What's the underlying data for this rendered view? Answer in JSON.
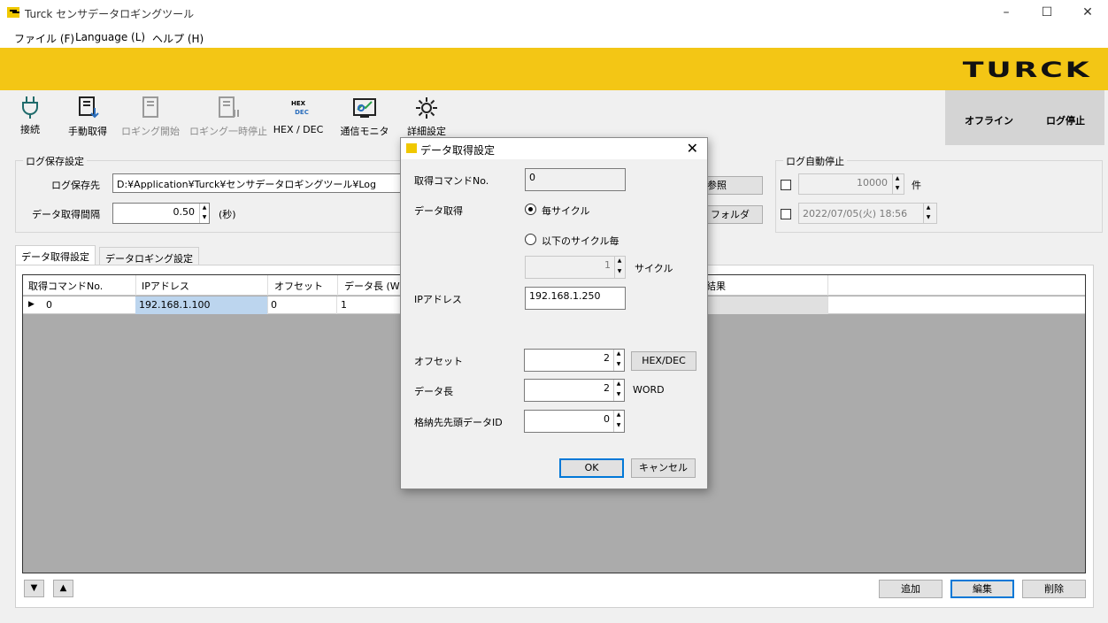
{
  "window": {
    "title": "Turck センサデータロギングツール",
    "min": "–",
    "max": "☐",
    "close": "✕"
  },
  "menu": [
    "ファイル (F)",
    "Language (L)",
    "ヘルプ (H)"
  ],
  "banner": {
    "brand": "TURCK",
    "color": "#f3c615"
  },
  "toolbar": [
    {
      "label": "接続",
      "icon": "plug-icon"
    },
    {
      "label": "手動取得",
      "icon": "notebook-download-icon"
    },
    {
      "label": "ロギング開始",
      "icon": "notebook-icon"
    },
    {
      "label": "ロギング一時停止",
      "icon": "notebook-pause-icon"
    },
    {
      "label": "HEX / DEC",
      "icon": "hex-dec-icon",
      "icon_top": "HEX",
      "icon_bottom": "DEC"
    },
    {
      "label": "通信モニタ",
      "icon": "monitor-icon"
    },
    {
      "label": "詳細設定",
      "icon": "gear-icon"
    }
  ],
  "status": {
    "connection": "オフライン",
    "logging": "ログ停止"
  },
  "log_save": {
    "group": "ログ保存設定",
    "dest_label": "ログ保存先",
    "dest_value": "D:¥Application¥Turck¥センサデータロギングツール¥Log",
    "interval_label": "データ取得間隔",
    "interval_value": "0.50",
    "interval_unit": "(秒)",
    "browse": "参照",
    "open_folder": "フォルダ"
  },
  "auto_stop": {
    "group": "ログ自動停止",
    "count_value": "10000",
    "count_unit": "件",
    "datetime_value": "2022/07/05(火) 18:56"
  },
  "tabs": [
    "データ取得設定",
    "データロギング設定"
  ],
  "grid": {
    "headers": [
      "取得コマンドNo.",
      "IPアドレス",
      "オフセット",
      "データ長 (W",
      "結果"
    ],
    "row": {
      "marker": "▶",
      "cmd": "0",
      "ip": "192.168.1.100",
      "offset": "0",
      "length": "1"
    }
  },
  "bottom_buttons": {
    "add": "追加",
    "edit": "編集",
    "delete": "削除"
  },
  "dialog": {
    "title": "データ取得設定",
    "cmd_label": "取得コマンドNo.",
    "cmd_value": "0",
    "acq_label": "データ取得",
    "opt_every": "毎サイクル",
    "opt_interval": "以下のサイクル毎",
    "cycle_value": "1",
    "cycle_unit": "サイクル",
    "ip_label": "IPアドレス",
    "ip_value": "192.168.1.250",
    "offset_label": "オフセット",
    "offset_value": "2",
    "hexdec": "HEX/DEC",
    "length_label": "データ長",
    "length_value": "2",
    "length_unit": "WORD",
    "dataid_label": "格納先先頭データID",
    "dataid_value": "0",
    "ok": "OK",
    "cancel": "キャンセル"
  }
}
